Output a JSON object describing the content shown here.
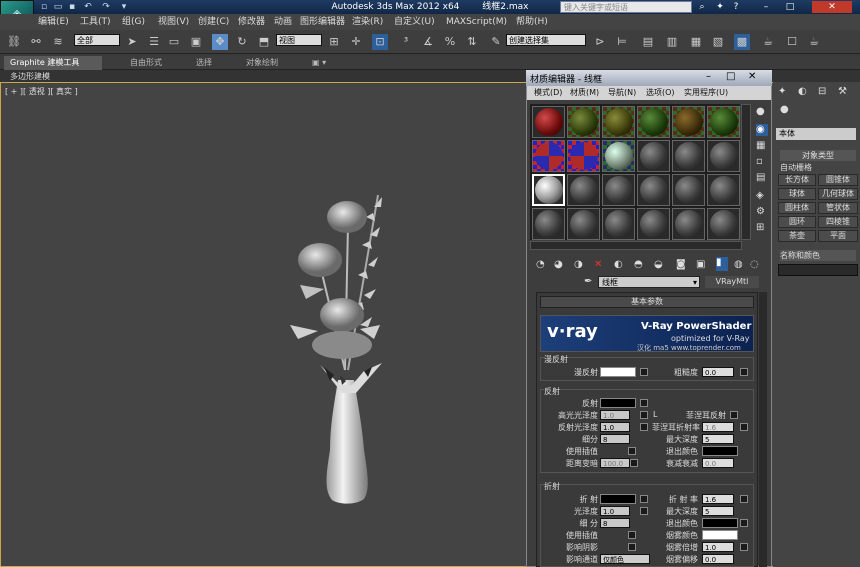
{
  "app": {
    "title": "Autodesk 3ds Max  2012 x64",
    "file": "线框2.max",
    "search_placeholder": "键入关键字或短语"
  },
  "menus": [
    "编辑(E)",
    "工具(T)",
    "组(G)",
    "视图(V)",
    "创建(C)",
    "修改器",
    "动画",
    "图形编辑器",
    "渲染(R)",
    "自定义(U)",
    "MAXScript(M)",
    "帮助(H)"
  ],
  "toolbar": {
    "selection_filter": "全部",
    "view_dropdown": "视图",
    "named_selection": "创建选择集"
  },
  "ribbon": {
    "tabs": [
      "Graphite 建模工具",
      "自由形式",
      "选择",
      "对象绘制"
    ],
    "subtitle": "多边形建模"
  },
  "viewport": {
    "label": "[ + ][ 透视 ][ 真实 ]"
  },
  "material_editor": {
    "title": "材质编辑器 - 线框",
    "menu": [
      "模式(D)",
      "材质(M)",
      "导航(N)",
      "选项(O)",
      "实用程序(U)"
    ],
    "material_name": "线框",
    "material_type": "VRayMtl",
    "rollout_title": "基本参数",
    "banner_logo": "v·ray",
    "banner_title": "V-Ray PowerShader",
    "banner_subtitle": "optimized for V-Ray",
    "banner_site": "汉化 ma5 www.toprender.com",
    "sections": {
      "diffuse": {
        "title": "漫反射",
        "diffuse_label": "漫反射",
        "roughness_label": "粗糙度",
        "roughness_value": "0.0"
      },
      "reflection": {
        "title": "反射",
        "reflect_label": "反射",
        "hilight_gloss_label": "高光光泽度",
        "hilight_gloss_value": "1.0",
        "lock_label": "L",
        "fresnel_label": "菲涅耳反射",
        "refl_gloss_label": "反射光泽度",
        "refl_gloss_value": "1.0",
        "fresnel_ior_label": "菲涅耳折射率",
        "fresnel_ior_value": "1.6",
        "subdivs_label": "细分",
        "subdivs_value": "8",
        "max_depth_label": "最大深度",
        "max_depth_value": "5",
        "use_interp_label": "使用插值",
        "exit_color_label": "退出颜色",
        "dim_distance_label": "距离变暗",
        "dim_distance_value": "100.0",
        "dim_falloff_label": "衰减衰减",
        "dim_falloff_value": "0.0"
      },
      "refraction": {
        "title": "折射",
        "refract_label": "折 射",
        "ior_label": "折 射 率",
        "ior_value": "1.6",
        "gloss_label": "光泽度",
        "gloss_value": "1.0",
        "max_depth_label": "最大深度",
        "max_depth_value": "5",
        "subdivs_label": "细 分",
        "subdivs_value": "8",
        "exit_color_label": "退出颜色",
        "use_interp_label": "使用插值",
        "fog_color_label": "烟雾颜色",
        "shadows_label": "影响阴影",
        "fog_mult_label": "烟雾倍增",
        "fog_mult_value": "1.0",
        "affect_channels_label": "影响通道",
        "affect_channels_value": "仅颜色",
        "fog_bias_label": "烟雾偏移",
        "fog_bias_value": "0.0"
      }
    }
  },
  "command_panel": {
    "dropdown": "本体",
    "rollout": "对象类型",
    "autogrid": "自动栅格",
    "buttons": [
      [
        "长方体",
        "圆锥体"
      ],
      [
        "球体",
        "几何球体"
      ],
      [
        "圆柱体",
        "管状体"
      ],
      [
        "圆环",
        "四棱锥"
      ],
      [
        "茶壶",
        "平面"
      ]
    ],
    "name_color": "名称和颜色"
  },
  "colors": {
    "viewport_border": "#c9a84a",
    "banner": "#1d3f7a",
    "diffuse_swatch": "#ffffff",
    "reflect_swatch": "#000000"
  }
}
